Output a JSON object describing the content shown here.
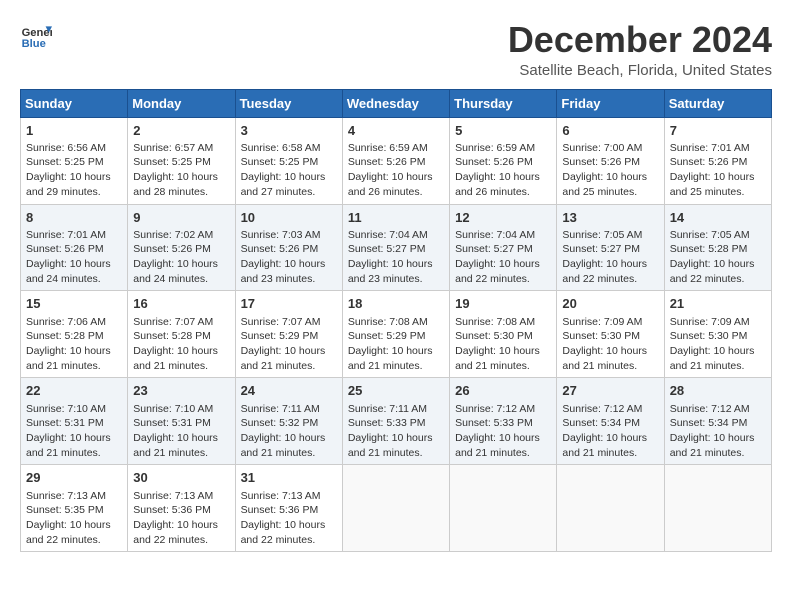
{
  "header": {
    "logo_line1": "General",
    "logo_line2": "Blue",
    "month": "December 2024",
    "location": "Satellite Beach, Florida, United States"
  },
  "weekdays": [
    "Sunday",
    "Monday",
    "Tuesday",
    "Wednesday",
    "Thursday",
    "Friday",
    "Saturday"
  ],
  "weeks": [
    [
      {
        "day": "1",
        "info": "Sunrise: 6:56 AM\nSunset: 5:25 PM\nDaylight: 10 hours\nand 29 minutes."
      },
      {
        "day": "2",
        "info": "Sunrise: 6:57 AM\nSunset: 5:25 PM\nDaylight: 10 hours\nand 28 minutes."
      },
      {
        "day": "3",
        "info": "Sunrise: 6:58 AM\nSunset: 5:25 PM\nDaylight: 10 hours\nand 27 minutes."
      },
      {
        "day": "4",
        "info": "Sunrise: 6:59 AM\nSunset: 5:26 PM\nDaylight: 10 hours\nand 26 minutes."
      },
      {
        "day": "5",
        "info": "Sunrise: 6:59 AM\nSunset: 5:26 PM\nDaylight: 10 hours\nand 26 minutes."
      },
      {
        "day": "6",
        "info": "Sunrise: 7:00 AM\nSunset: 5:26 PM\nDaylight: 10 hours\nand 25 minutes."
      },
      {
        "day": "7",
        "info": "Sunrise: 7:01 AM\nSunset: 5:26 PM\nDaylight: 10 hours\nand 25 minutes."
      }
    ],
    [
      {
        "day": "8",
        "info": "Sunrise: 7:01 AM\nSunset: 5:26 PM\nDaylight: 10 hours\nand 24 minutes."
      },
      {
        "day": "9",
        "info": "Sunrise: 7:02 AM\nSunset: 5:26 PM\nDaylight: 10 hours\nand 24 minutes."
      },
      {
        "day": "10",
        "info": "Sunrise: 7:03 AM\nSunset: 5:26 PM\nDaylight: 10 hours\nand 23 minutes."
      },
      {
        "day": "11",
        "info": "Sunrise: 7:04 AM\nSunset: 5:27 PM\nDaylight: 10 hours\nand 23 minutes."
      },
      {
        "day": "12",
        "info": "Sunrise: 7:04 AM\nSunset: 5:27 PM\nDaylight: 10 hours\nand 22 minutes."
      },
      {
        "day": "13",
        "info": "Sunrise: 7:05 AM\nSunset: 5:27 PM\nDaylight: 10 hours\nand 22 minutes."
      },
      {
        "day": "14",
        "info": "Sunrise: 7:05 AM\nSunset: 5:28 PM\nDaylight: 10 hours\nand 22 minutes."
      }
    ],
    [
      {
        "day": "15",
        "info": "Sunrise: 7:06 AM\nSunset: 5:28 PM\nDaylight: 10 hours\nand 21 minutes."
      },
      {
        "day": "16",
        "info": "Sunrise: 7:07 AM\nSunset: 5:28 PM\nDaylight: 10 hours\nand 21 minutes."
      },
      {
        "day": "17",
        "info": "Sunrise: 7:07 AM\nSunset: 5:29 PM\nDaylight: 10 hours\nand 21 minutes."
      },
      {
        "day": "18",
        "info": "Sunrise: 7:08 AM\nSunset: 5:29 PM\nDaylight: 10 hours\nand 21 minutes."
      },
      {
        "day": "19",
        "info": "Sunrise: 7:08 AM\nSunset: 5:30 PM\nDaylight: 10 hours\nand 21 minutes."
      },
      {
        "day": "20",
        "info": "Sunrise: 7:09 AM\nSunset: 5:30 PM\nDaylight: 10 hours\nand 21 minutes."
      },
      {
        "day": "21",
        "info": "Sunrise: 7:09 AM\nSunset: 5:30 PM\nDaylight: 10 hours\nand 21 minutes."
      }
    ],
    [
      {
        "day": "22",
        "info": "Sunrise: 7:10 AM\nSunset: 5:31 PM\nDaylight: 10 hours\nand 21 minutes."
      },
      {
        "day": "23",
        "info": "Sunrise: 7:10 AM\nSunset: 5:31 PM\nDaylight: 10 hours\nand 21 minutes."
      },
      {
        "day": "24",
        "info": "Sunrise: 7:11 AM\nSunset: 5:32 PM\nDaylight: 10 hours\nand 21 minutes."
      },
      {
        "day": "25",
        "info": "Sunrise: 7:11 AM\nSunset: 5:33 PM\nDaylight: 10 hours\nand 21 minutes."
      },
      {
        "day": "26",
        "info": "Sunrise: 7:12 AM\nSunset: 5:33 PM\nDaylight: 10 hours\nand 21 minutes."
      },
      {
        "day": "27",
        "info": "Sunrise: 7:12 AM\nSunset: 5:34 PM\nDaylight: 10 hours\nand 21 minutes."
      },
      {
        "day": "28",
        "info": "Sunrise: 7:12 AM\nSunset: 5:34 PM\nDaylight: 10 hours\nand 21 minutes."
      }
    ],
    [
      {
        "day": "29",
        "info": "Sunrise: 7:13 AM\nSunset: 5:35 PM\nDaylight: 10 hours\nand 22 minutes."
      },
      {
        "day": "30",
        "info": "Sunrise: 7:13 AM\nSunset: 5:36 PM\nDaylight: 10 hours\nand 22 minutes."
      },
      {
        "day": "31",
        "info": "Sunrise: 7:13 AM\nSunset: 5:36 PM\nDaylight: 10 hours\nand 22 minutes."
      },
      {
        "day": "",
        "info": ""
      },
      {
        "day": "",
        "info": ""
      },
      {
        "day": "",
        "info": ""
      },
      {
        "day": "",
        "info": ""
      }
    ]
  ]
}
